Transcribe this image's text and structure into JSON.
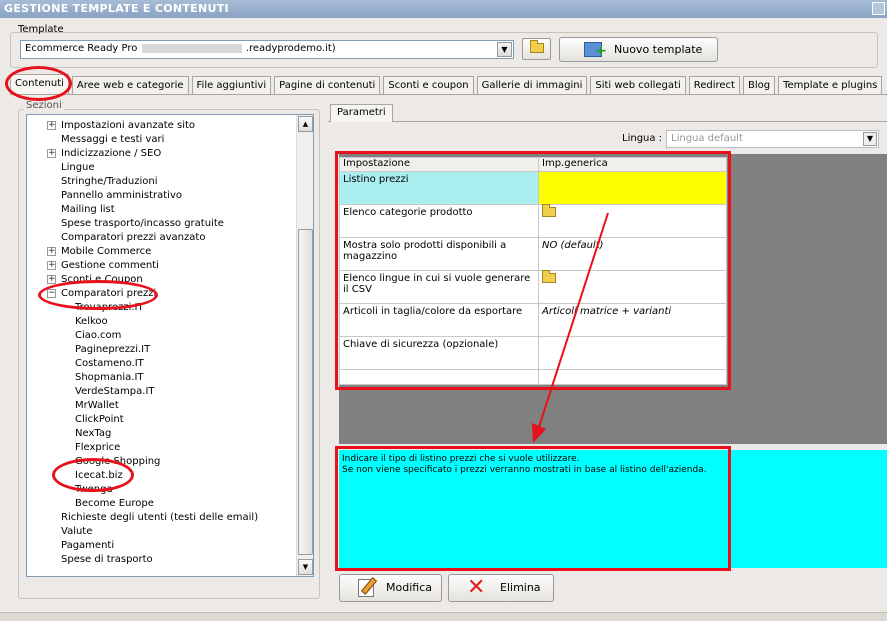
{
  "window": {
    "title": "GESTIONE TEMPLATE E CONTENUTI"
  },
  "template": {
    "label": "Template",
    "selected_prefix": "Ecommerce Ready Pro",
    "selected_suffix": ".readyprodemo.it)",
    "new_button_label": "Nuovo template"
  },
  "tabs": [
    {
      "label": "Contenuti",
      "active": true
    },
    {
      "label": "Aree web e categorie"
    },
    {
      "label": "File aggiuntivi"
    },
    {
      "label": "Pagine di contenuti"
    },
    {
      "label": "Sconti e coupon"
    },
    {
      "label": "Gallerie di immagini"
    },
    {
      "label": "Siti web collegati"
    },
    {
      "label": "Redirect"
    },
    {
      "label": "Blog"
    },
    {
      "label": "Template e plugins"
    }
  ],
  "sections": {
    "label": "Sezioni",
    "items": [
      {
        "label": "Impostazioni avanzate sito",
        "expander": "+"
      },
      {
        "label": "Messaggi e testi vari"
      },
      {
        "label": "Indicizzazione / SEO",
        "expander": "+"
      },
      {
        "label": "Lingue"
      },
      {
        "label": "Stringhe/Traduzioni"
      },
      {
        "label": "Pannello amministrativo"
      },
      {
        "label": "Mailing list"
      },
      {
        "label": "Spese trasporto/incasso gratuite"
      },
      {
        "label": "Comparatori prezzi avanzato"
      },
      {
        "label": "Mobile Commerce",
        "expander": "+"
      },
      {
        "label": "Gestione commenti",
        "expander": "+"
      },
      {
        "label": "Sconti e Coupon",
        "expander": "+"
      },
      {
        "label": "Comparatori prezzi",
        "expander": "−"
      },
      {
        "label": "Trovaprezzi.IT"
      },
      {
        "label": "Kelkoo"
      },
      {
        "label": "Ciao.com"
      },
      {
        "label": "Pagineprezzi.IT"
      },
      {
        "label": "Costameno.IT"
      },
      {
        "label": "Shopmania.IT"
      },
      {
        "label": "VerdeStampa.IT"
      },
      {
        "label": "MrWallet"
      },
      {
        "label": "ClickPoint"
      },
      {
        "label": "NexTag"
      },
      {
        "label": "Flexprice"
      },
      {
        "label": "Google Shopping"
      },
      {
        "label": "Icecat.biz",
        "selected": true
      },
      {
        "label": "Twenga"
      },
      {
        "label": "Become Europe"
      },
      {
        "label": "Richieste degli utenti (testi delle email)"
      },
      {
        "label": "Valute"
      },
      {
        "label": "Pagamenti"
      },
      {
        "label": "Spese di trasporto"
      }
    ]
  },
  "params": {
    "tab_label": "Parametri",
    "language_label": "Lingua :",
    "language_value": "Lingua default",
    "grid": {
      "headers": [
        "Impostazione",
        "Imp.generica"
      ],
      "rows": [
        {
          "setting": "Listino prezzi",
          "value": ""
        },
        {
          "setting": "Elenco categorie prodotto",
          "value": "",
          "icon": "folder-icon"
        },
        {
          "setting": "Mostra solo prodotti disponibili a magazzino",
          "value": "NO (default)"
        },
        {
          "setting": "Elenco lingue in cui si vuole generare il CSV",
          "value": "",
          "icon": "folder-icon"
        },
        {
          "setting": "Articoli in taglia/colore da esportare",
          "value": "Articoli matrice + varianti"
        },
        {
          "setting": "Chiave di sicurezza (opzionale)",
          "value": ""
        }
      ]
    },
    "help_line1": "Indicare il tipo di listino prezzi che si vuole utilizzare.",
    "help_line2": "Se non viene specificato i prezzi verranno mostrati in base al listino dell'azienda.",
    "edit_button": "Modifica",
    "delete_button": "Elimina"
  },
  "colors": {
    "highlight_red": "#e8101a",
    "help_background": "#00ffff",
    "selected_cell": "#ffff00",
    "selected_row": "#aaeef0"
  }
}
